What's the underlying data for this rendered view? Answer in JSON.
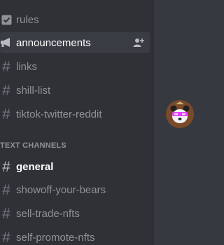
{
  "sidebar": {
    "channels_top": [
      {
        "label": "rules",
        "icon": "rules-checkbox-icon"
      },
      {
        "label": "announcements",
        "icon": "announcement-megaphone-icon",
        "selected": true
      },
      {
        "label": "links",
        "icon": "hash-icon"
      },
      {
        "label": "shill-list",
        "icon": "hash-icon"
      },
      {
        "label": "tiktok-twitter-reddit",
        "icon": "hash-icon"
      }
    ],
    "category": {
      "label": "TEXT CHANNELS"
    },
    "text_channels": [
      {
        "label": "general",
        "unread": true
      },
      {
        "label": "showoff-your-bears"
      },
      {
        "label": "sell-trade-nfts"
      },
      {
        "label": "self-promote-nfts"
      }
    ]
  },
  "colors": {
    "sidebar_bg": "#2f3136",
    "main_bg": "#36393f",
    "selected_bg": "#393c43",
    "muted_text": "#8e9297",
    "active_text": "#ffffff",
    "avatar_accent": "#e040fb"
  },
  "main": {
    "avatar": {
      "icon": "panda-bear-avatar"
    }
  }
}
